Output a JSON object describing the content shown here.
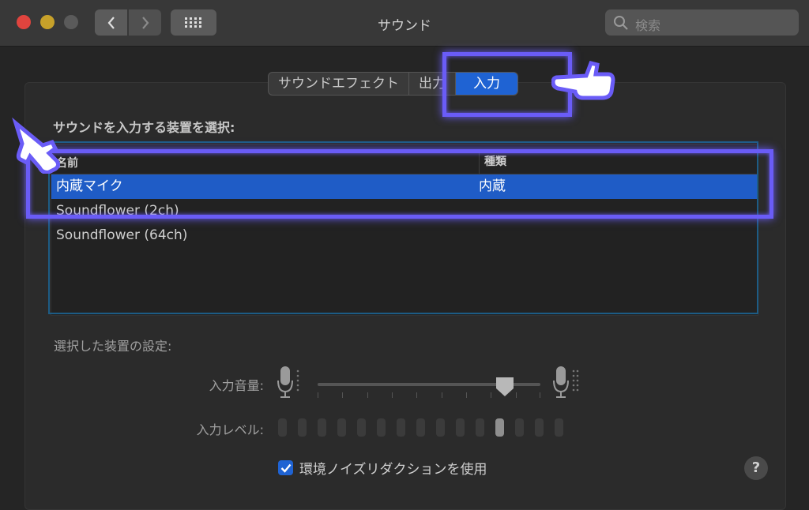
{
  "window": {
    "title": "サウンド"
  },
  "search": {
    "placeholder": "検索"
  },
  "tabs": [
    {
      "label": "サウンドエフェクト",
      "active": false
    },
    {
      "label": "出力",
      "active": false
    },
    {
      "label": "入力",
      "active": true
    }
  ],
  "device_section": {
    "heading": "サウンドを入力する装置を選択:",
    "columns": [
      "名前",
      "種類"
    ],
    "rows": [
      {
        "name": "内蔵マイク",
        "type": "内蔵",
        "selected": true
      },
      {
        "name": "Soundflower (2ch)",
        "type": "",
        "selected": false
      },
      {
        "name": "Soundflower (64ch)",
        "type": "",
        "selected": false
      }
    ]
  },
  "settings": {
    "heading": "選択した装置の設定:",
    "input_volume_label": "入力音量:",
    "input_volume_value": 0.85,
    "input_level_label": "入力レベル:",
    "input_level_active_index": 11,
    "noise_reduction_label": "環境ノイズリダクションを使用",
    "noise_reduction_checked": true
  },
  "help": {
    "label": "?"
  },
  "colors": {
    "accent": "#1f63d3",
    "highlight": "#6a5cf7",
    "teal_box": "#1d5c85"
  }
}
